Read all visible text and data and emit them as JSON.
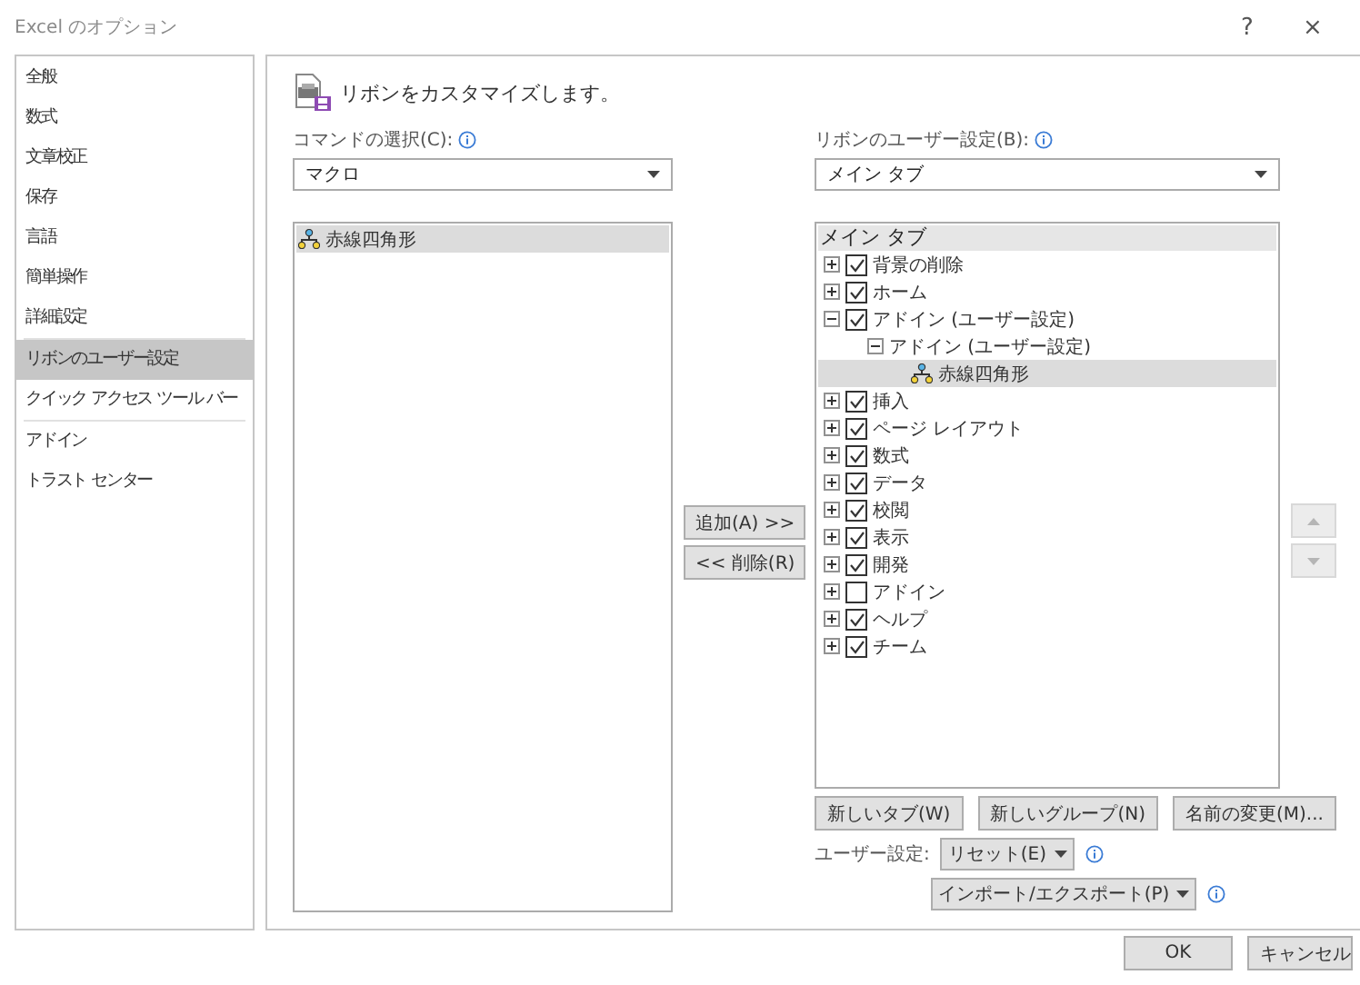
{
  "window": {
    "title": "Excel のオプション",
    "help": "?",
    "close": "×"
  },
  "sidebar": {
    "sections": [
      {
        "items": [
          {
            "label": "全般",
            "selected": false
          },
          {
            "label": "数式",
            "selected": false
          },
          {
            "label": "文章校正",
            "selected": false
          },
          {
            "label": "保存",
            "selected": false
          },
          {
            "label": "言語",
            "selected": false
          },
          {
            "label": "簡単操作",
            "selected": false
          },
          {
            "label": "詳細設定",
            "selected": false
          }
        ]
      },
      {
        "items": [
          {
            "label": "リボンのユーザー設定",
            "selected": true
          },
          {
            "label": "クイック アクセス ツール バー",
            "selected": false
          }
        ]
      },
      {
        "items": [
          {
            "label": "アドイン",
            "selected": false
          },
          {
            "label": "トラスト センター",
            "selected": false
          }
        ]
      }
    ]
  },
  "main": {
    "heading": "リボンをカスタマイズします。",
    "commands": {
      "label": "コマンドの選択(C):",
      "value": "マクロ",
      "items": [
        {
          "label": "赤線四角形",
          "selected": true
        }
      ]
    },
    "transfer_buttons": [
      "追加(A) >>",
      "<< 削除(R)"
    ],
    "ribbon": {
      "label": "リボンのユーザー設定(B):",
      "value": "メイン タブ",
      "tree_header": "メイン タブ",
      "tree": [
        {
          "kind": "tab",
          "label": "背景の削除",
          "checked": true,
          "expanded": false
        },
        {
          "kind": "tab",
          "label": "ホーム",
          "checked": true,
          "expanded": false
        },
        {
          "kind": "tab",
          "label": "アドイン (ユーザー設定)",
          "checked": true,
          "expanded": true,
          "children": [
            {
              "kind": "group",
              "label": "アドイン (ユーザー設定)",
              "expanded": true,
              "children": [
                {
                  "kind": "command",
                  "label": "赤線四角形",
                  "selected": true
                }
              ]
            }
          ]
        },
        {
          "kind": "tab",
          "label": "挿入",
          "checked": true,
          "expanded": false
        },
        {
          "kind": "tab",
          "label": "ページ レイアウト",
          "checked": true,
          "expanded": false
        },
        {
          "kind": "tab",
          "label": "数式",
          "checked": true,
          "expanded": false
        },
        {
          "kind": "tab",
          "label": "データ",
          "checked": true,
          "expanded": false
        },
        {
          "kind": "tab",
          "label": "校閲",
          "checked": true,
          "expanded": false
        },
        {
          "kind": "tab",
          "label": "表示",
          "checked": true,
          "expanded": false
        },
        {
          "kind": "tab",
          "label": "開発",
          "checked": true,
          "expanded": false
        },
        {
          "kind": "tab",
          "label": "アドイン",
          "checked": false,
          "expanded": false
        },
        {
          "kind": "tab",
          "label": "ヘルプ",
          "checked": true,
          "expanded": false
        },
        {
          "kind": "tab",
          "label": "チーム",
          "checked": true,
          "expanded": false
        }
      ]
    },
    "move_buttons": [
      {
        "kind": "up",
        "disabled": true
      },
      {
        "kind": "down",
        "disabled": true
      }
    ],
    "tree_buttons": [
      "新しいタブ(W)",
      "新しいグループ(N)",
      "名前の変更(M)..."
    ],
    "customizations": {
      "label": "ユーザー設定:",
      "reset": "リセット(E)",
      "import_export": "インポート/エクスポート(P)"
    }
  },
  "footer": {
    "buttons": [
      "OK",
      "キャンセル"
    ]
  }
}
